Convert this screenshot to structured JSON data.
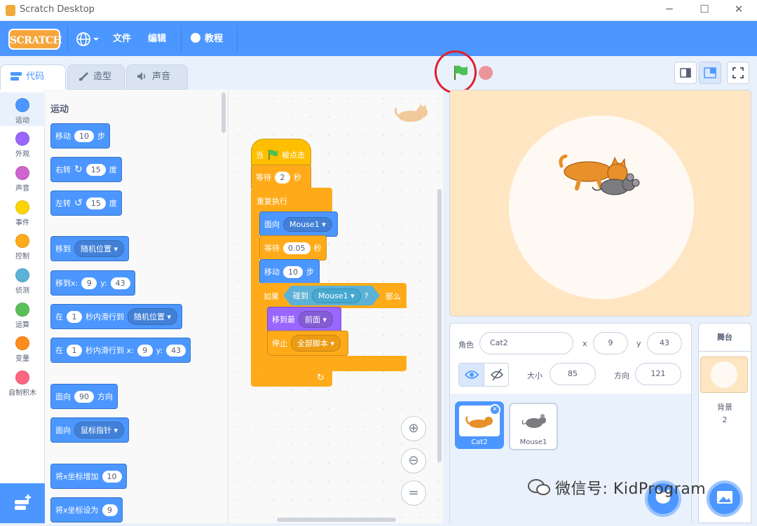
{
  "window": {
    "title": "Scratch Desktop"
  },
  "menubar": {
    "logo": "SCRATCH",
    "file": "文件",
    "edit": "编辑",
    "tutorials": "教程"
  },
  "tabs": [
    {
      "label": "代码"
    },
    {
      "label": "造型"
    },
    {
      "label": "声音"
    }
  ],
  "categories": [
    {
      "label": "运动",
      "color": "#4c97ff"
    },
    {
      "label": "外观",
      "color": "#9966ff"
    },
    {
      "label": "声音",
      "color": "#cf63cf"
    },
    {
      "label": "事件",
      "color": "#ffd500"
    },
    {
      "label": "控制",
      "color": "#ffab19"
    },
    {
      "label": "侦测",
      "color": "#5cb1d6"
    },
    {
      "label": "运算",
      "color": "#59c059"
    },
    {
      "label": "变量",
      "color": "#ff8c1a"
    },
    {
      "label": "自制积木",
      "color": "#ff6680"
    }
  ],
  "palette": {
    "title": "运动",
    "move": {
      "a": "移动",
      "v": "10",
      "b": "步"
    },
    "turn_right": {
      "a": "右转",
      "v": "15",
      "b": "度"
    },
    "turn_left": {
      "a": "左转",
      "v": "15",
      "b": "度"
    },
    "goto": {
      "a": "移到",
      "dd": "随机位置"
    },
    "goto_xy": {
      "a": "移到x:",
      "x": "9",
      "b": "y:",
      "y": "43"
    },
    "glide": {
      "a": "在",
      "v": "1",
      "b": "秒内滑行到",
      "dd": "随机位置"
    },
    "glide_xy": {
      "a": "在",
      "v": "1",
      "b": "秒内滑行到 x:",
      "x": "9",
      "c": "y:",
      "y": "43"
    },
    "point_dir": {
      "a": "面向",
      "v": "90",
      "b": "方向"
    },
    "point_to": {
      "a": "面向",
      "dd": "鼠标指针"
    },
    "change_x": {
      "a": "将x坐标增加",
      "v": "10"
    },
    "set_x": {
      "a": "将x坐标设为",
      "v": "9"
    }
  },
  "script": {
    "hat": {
      "a": "当",
      "b": "被点击"
    },
    "wait1": {
      "a": "等待",
      "v": "2",
      "b": "秒"
    },
    "forever": "重复执行",
    "point": {
      "a": "面向",
      "dd": "Mouse1"
    },
    "wait2": {
      "a": "等待",
      "v": "0.05",
      "b": "秒"
    },
    "move": {
      "a": "移动",
      "v": "10",
      "b": "步"
    },
    "if": {
      "a": "如果",
      "touch": "碰到",
      "dd": "Mouse1",
      "q": "?",
      "then": "那么"
    },
    "front": {
      "a": "移到最",
      "dd": "前面"
    },
    "stop": {
      "a": "停止",
      "dd": "全部脚本"
    }
  },
  "sprite_info": {
    "sprite_label": "角色",
    "name": "Cat2",
    "x_label": "x",
    "x": "9",
    "y_label": "y",
    "y": "43",
    "size_label": "大小",
    "size": "85",
    "dir_label": "方向",
    "direction": "121"
  },
  "sprites": [
    {
      "name": "Cat2"
    },
    {
      "name": "Mouse1"
    }
  ],
  "stage_pane": {
    "title": "舞台",
    "backdrop_label": "背景",
    "backdrop_count": "2"
  },
  "watermark": "微信号: KidProgram"
}
